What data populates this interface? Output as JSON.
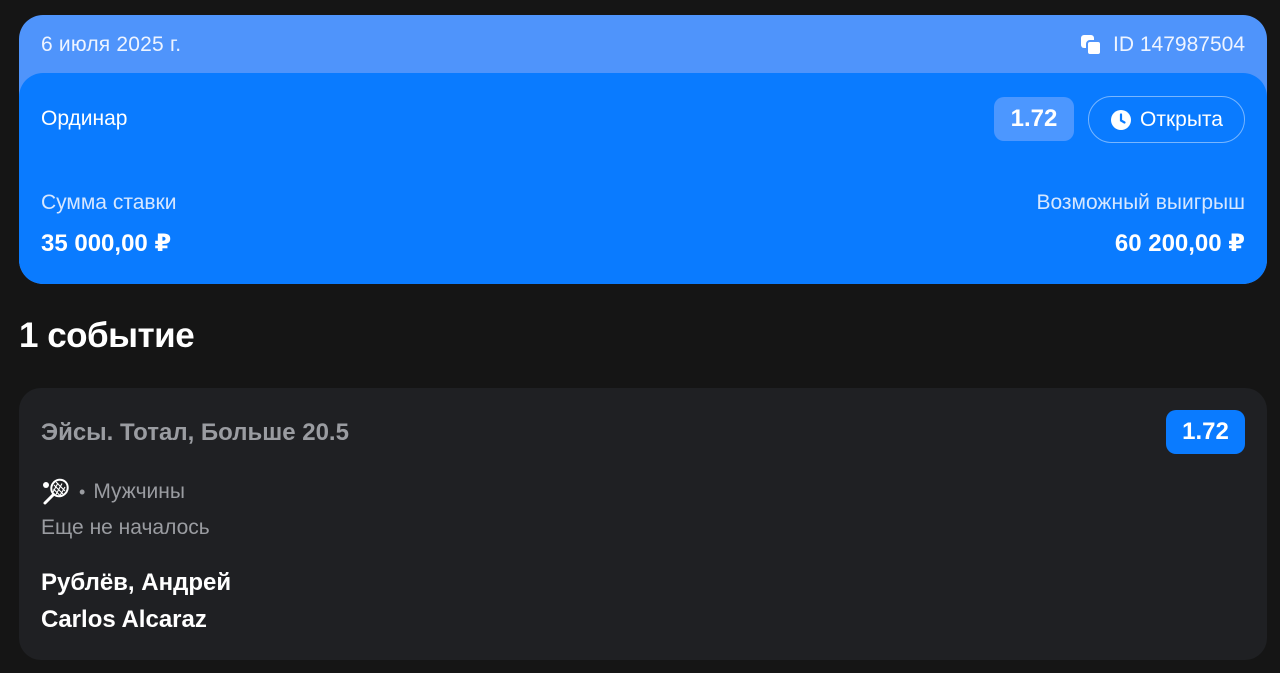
{
  "bet": {
    "date": "6 июля 2025 г.",
    "id_text": "ID 147987504",
    "type": "Ординар",
    "coefficient": "1.72",
    "status": "Открыта",
    "stake_label": "Сумма ставки",
    "stake_value": "35 000,00 ₽",
    "win_label": "Возможный выигрыш",
    "win_value": "60 200,00 ₽"
  },
  "events_heading": "1 событие",
  "event": {
    "market": "Эйсы. Тотал, Больше 20.5",
    "coefficient": "1.72",
    "sport_icon": "tennis-racket-icon",
    "category": "Мужчины",
    "status": "Еще не началось",
    "player1": "Рублёв, Андрей",
    "player2": "Carlos Alcaraz"
  },
  "colors": {
    "background": "#151515",
    "header_strip": "#4f94fb",
    "card_blue": "#0a7bff",
    "event_card": "#1f2023"
  }
}
